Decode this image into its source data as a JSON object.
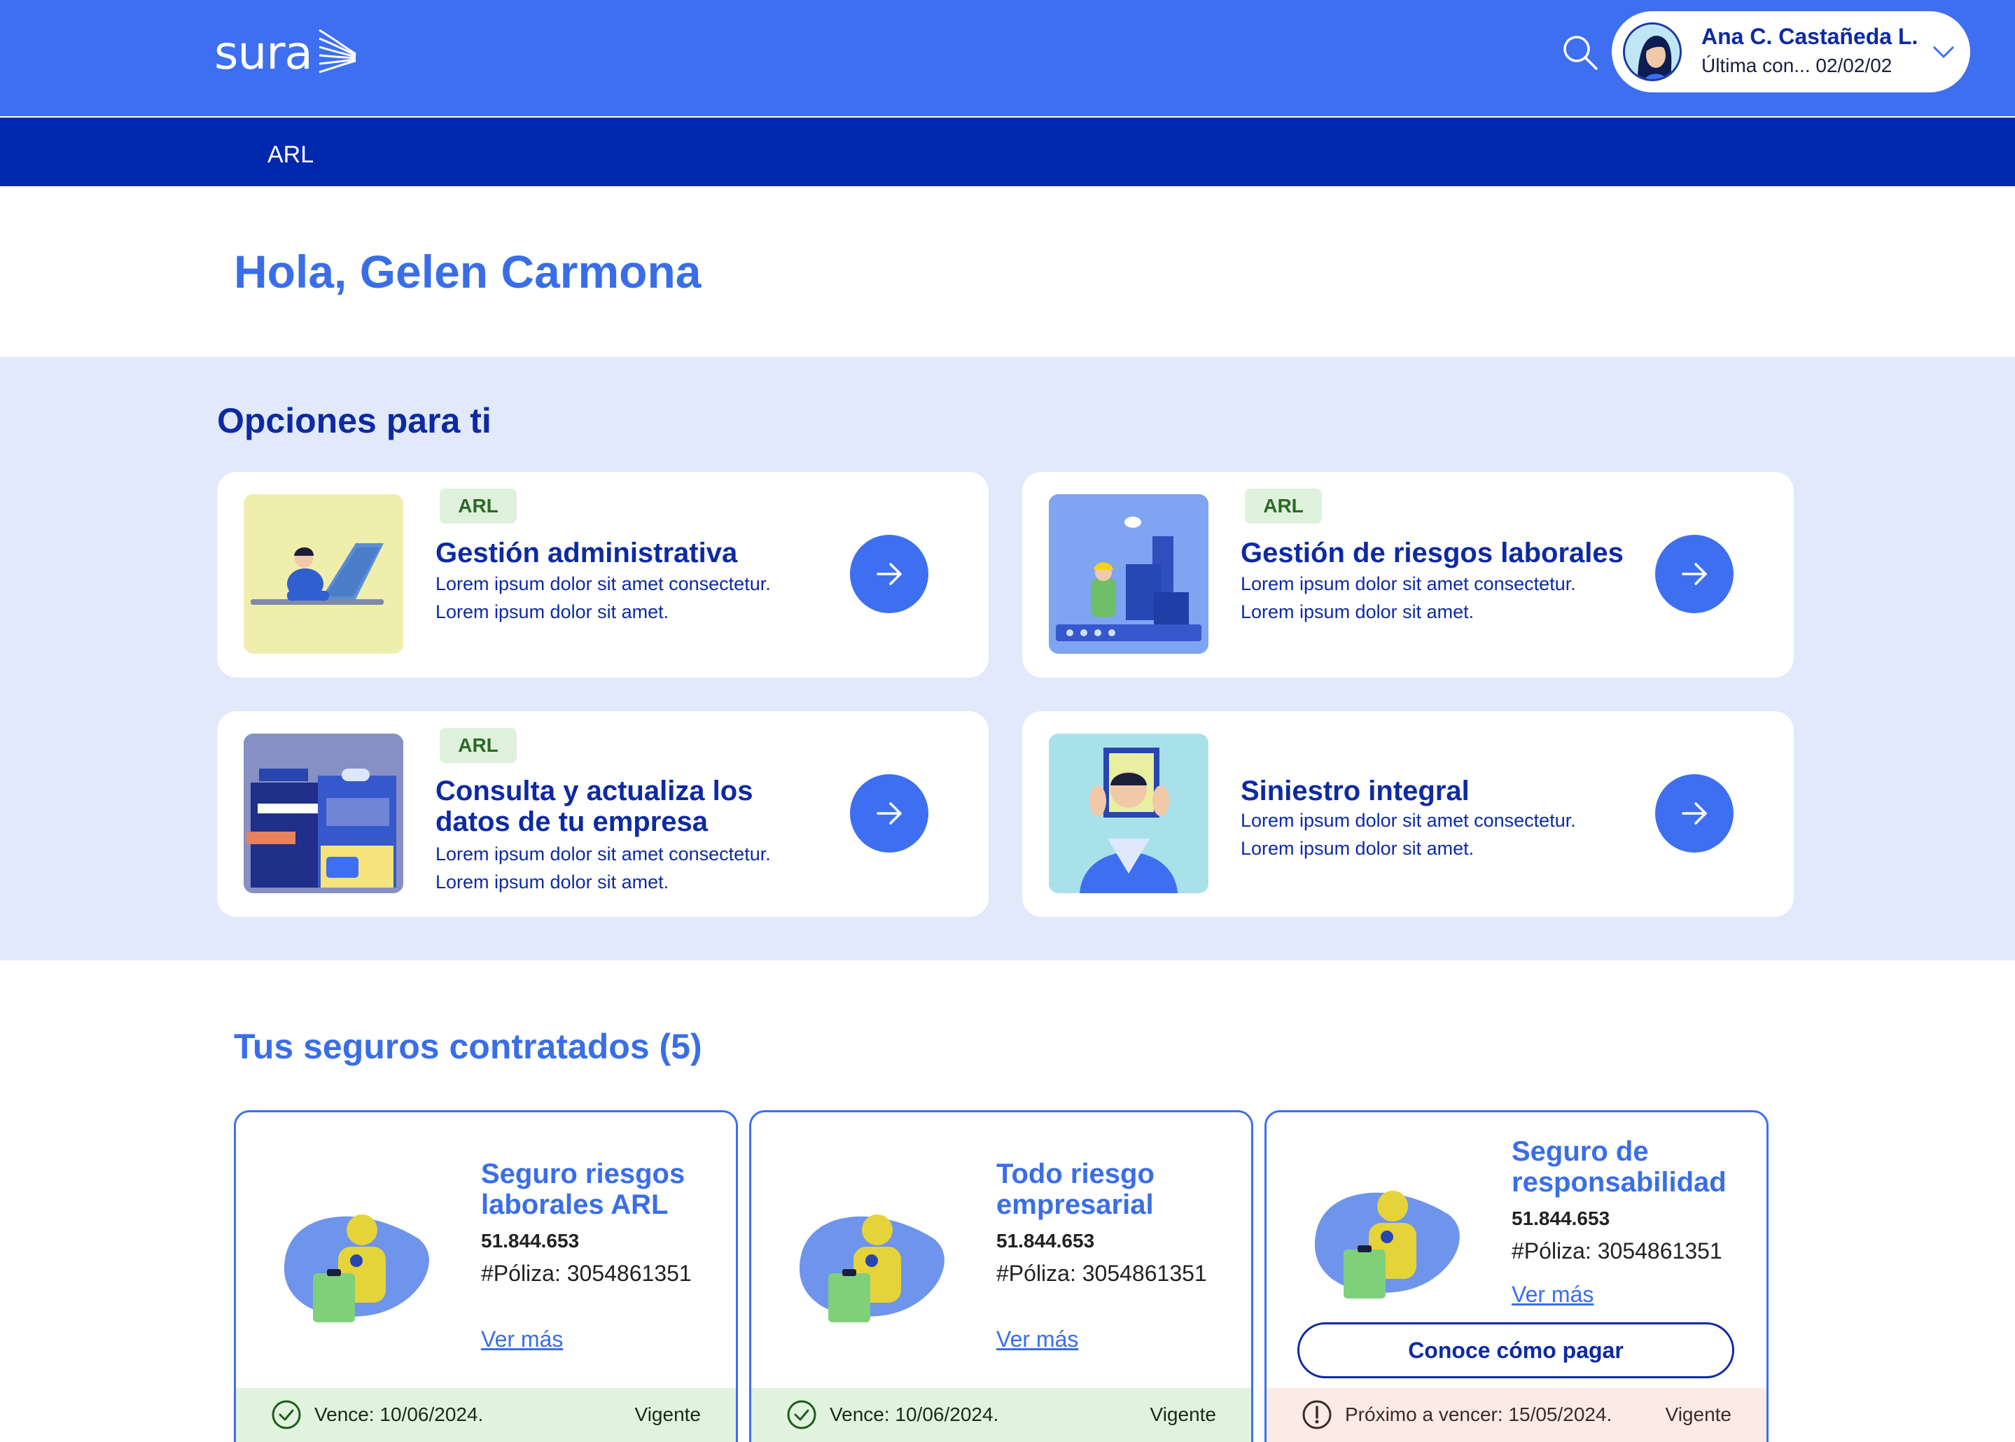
{
  "header": {
    "logo_text": "sura",
    "user": {
      "name": "Ana C. Castañeda L.",
      "last_connection": "Última con... 02/02/02"
    }
  },
  "nav": {
    "items": [
      "ARL"
    ]
  },
  "greeting": "Hola, Gelen Carmona",
  "options": {
    "title": "Opciones para ti",
    "cards": [
      {
        "badge": "ARL",
        "title": "Gestión administrativa",
        "desc_line1": "Lorem ipsum dolor sit amet consectetur.",
        "desc_line2": "Lorem ipsum dolor sit amet."
      },
      {
        "badge": "ARL",
        "title": "Gestión de riesgos laborales",
        "desc_line1": "Lorem ipsum dolor sit amet consectetur.",
        "desc_line2": "Lorem ipsum dolor sit amet."
      },
      {
        "badge": "ARL",
        "title": "Consulta y actualiza los datos de tu empresa",
        "desc_line1": "Lorem ipsum dolor sit amet consectetur.",
        "desc_line2": "Lorem ipsum dolor sit amet."
      },
      {
        "badge": "",
        "title": "Siniestro integral",
        "desc_line1": "Lorem ipsum dolor sit amet consectetur.",
        "desc_line2": "Lorem ipsum dolor sit amet."
      }
    ]
  },
  "insurance": {
    "title": "Tus seguros contratados (5)",
    "cards": [
      {
        "name": "Seguro riesgos laborales ARL",
        "number": "51.844.653",
        "policy": "#Póliza: 3054861351",
        "link": "Ver más",
        "due": "Vence: 10/06/2024.",
        "status": "Vigente"
      },
      {
        "name": "Todo riesgo empresarial",
        "number": "51.844.653",
        "policy": "#Póliza: 3054861351",
        "link": "Ver más",
        "due": "Vence: 10/06/2024.",
        "status": "Vigente"
      },
      {
        "name": "Seguro de responsabilidad",
        "number": "51.844.653",
        "policy": "#Póliza: 3054861351",
        "link": "Ver más",
        "pay_button": "Conoce cómo pagar",
        "due": "Próximo a vencer: 15/05/2024.",
        "status": "Vigente"
      }
    ]
  },
  "colors": {
    "primary": "#3d6ff0",
    "nav": "#0028ad",
    "options_bg": "#e1e9fa",
    "dark_text": "#0d2aa3",
    "ok_bg": "#e1f3df",
    "warn_bg": "#fcebe4"
  }
}
